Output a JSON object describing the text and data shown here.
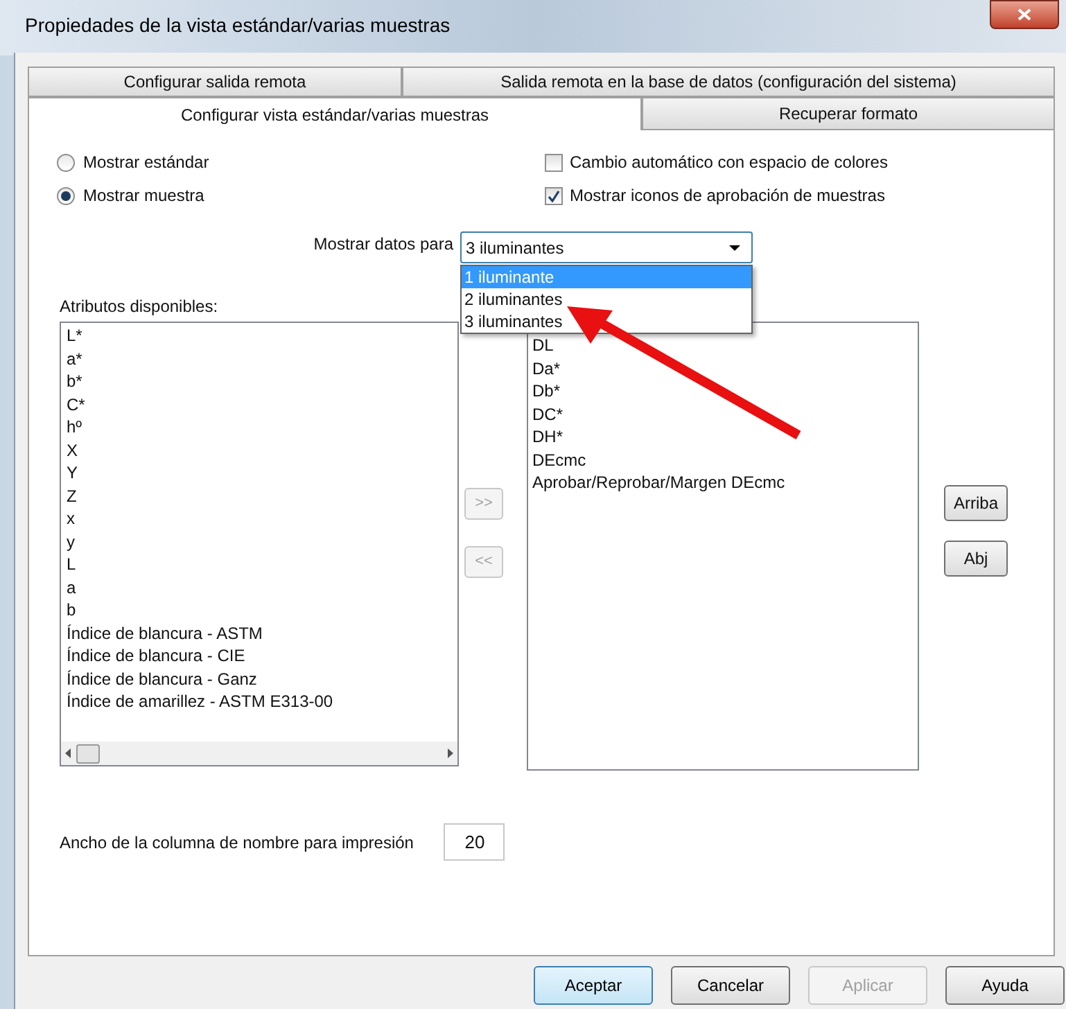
{
  "window": {
    "title": "Propiedades de la vista estándar/varias muestras"
  },
  "tab_rows": [
    [
      {
        "label": "Configurar salida remota",
        "selected": false
      },
      {
        "label": "Salida remota en la base de datos (configuración del sistema)",
        "selected": false
      }
    ],
    [
      {
        "label": "Configurar vista estándar/varias muestras",
        "selected": true
      },
      {
        "label": "Recuperar formato",
        "selected": false
      }
    ]
  ],
  "radios": [
    {
      "label": "Mostrar estándar",
      "selected": false
    },
    {
      "label": "Mostrar muestra",
      "selected": true
    }
  ],
  "checkboxes": [
    {
      "label": "Cambio automático con espacio de colores",
      "checked": false
    },
    {
      "label": "Mostrar iconos de aprobación de muestras",
      "checked": true
    }
  ],
  "show_data_for": {
    "label": "Mostrar datos para",
    "value": "3 iluminantes",
    "options": [
      {
        "label": "1 iluminante",
        "highlighted": true
      },
      {
        "label": "2 iluminantes",
        "highlighted": false
      },
      {
        "label": "3 iluminantes",
        "highlighted": false
      }
    ]
  },
  "available_attributes": {
    "label": "Atributos disponibles:",
    "items": [
      "L*",
      "a*",
      "b*",
      "C*",
      "hº",
      "X",
      "Y",
      "Z",
      "x",
      "y",
      "L",
      "a",
      "b",
      "Índice de blancura - ASTM",
      "Índice de blancura - CIE",
      "Índice de blancura - Ganz",
      "Índice de amarillez - ASTM E313-00"
    ]
  },
  "move_buttons": [
    {
      "label": ">>",
      "disabled": true
    },
    {
      "label": "<<",
      "disabled": true
    }
  ],
  "selected_attributes": {
    "items": [
      "DL",
      "Da*",
      "Db*",
      "DC*",
      "DH*",
      "DEcmc",
      "Aprobar/Reprobar/Margen DEcmc"
    ]
  },
  "order_buttons": [
    {
      "label": "Arriba"
    },
    {
      "label": "Abj"
    }
  ],
  "name_column_width": {
    "label": "Ancho de la columna de nombre para impresión",
    "value": "20"
  },
  "buttons": [
    {
      "label": "Aceptar",
      "default": true,
      "disabled": false
    },
    {
      "label": "Cancelar",
      "default": false,
      "disabled": false
    },
    {
      "label": "Aplicar",
      "default": false,
      "disabled": true
    },
    {
      "label": "Ayuda",
      "default": false,
      "disabled": false
    }
  ]
}
